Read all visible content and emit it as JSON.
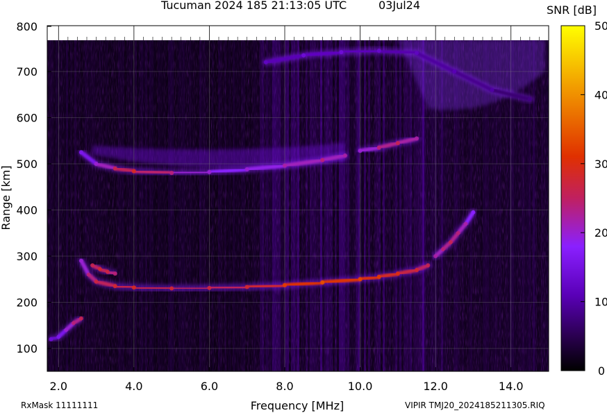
{
  "header": {
    "title": "Tucuman 2024 185 21:13:05 UTC",
    "date": "03Jul24"
  },
  "footer": {
    "rxmask": "RxMask 11111111",
    "file": "VIPIR  TMJ20_2024185211305.RIQ"
  },
  "chart_data": {
    "type": "heatmap",
    "title": "Tucuman 2024 185 21:13:05 UTC",
    "xlabel": "Frequency [MHz]",
    "ylabel": "Range [km]",
    "xlim": [
      1.7,
      15.0
    ],
    "ylim": [
      50,
      800
    ],
    "x_ticks": [
      "2.0",
      "4.0",
      "6.0",
      "8.0",
      "10.0",
      "12.0",
      "14.0"
    ],
    "x_tick_values": [
      2,
      4,
      6,
      8,
      10,
      12,
      14
    ],
    "y_ticks": [
      "100",
      "200",
      "300",
      "400",
      "500",
      "600",
      "700",
      "800"
    ],
    "y_tick_values": [
      100,
      200,
      300,
      400,
      500,
      600,
      700,
      800
    ],
    "colorbar": {
      "label": "SNR [dB]",
      "range": [
        0,
        50
      ],
      "ticks": [
        "0",
        "10",
        "20",
        "30",
        "40",
        "50"
      ],
      "tick_values": [
        0,
        10,
        20,
        30,
        40,
        50
      ],
      "colormap": [
        "#000000",
        "#2a0050",
        "#5a00b8",
        "#8a20ff",
        "#c02060",
        "#e03000",
        "#f09000",
        "#ffff00"
      ]
    },
    "grid": true,
    "traces": [
      {
        "kind": "F-layer virtual height (O)",
        "x": [
          2.6,
          2.8,
          3.0,
          3.5,
          4.0,
          5.0,
          6.0,
          7.0,
          8.0,
          9.0,
          10.0,
          10.5,
          11.0,
          11.5,
          11.8
        ],
        "y": [
          290,
          260,
          245,
          235,
          232,
          230,
          231,
          233,
          237,
          243,
          250,
          255,
          262,
          270,
          280
        ],
        "snr": [
          18,
          22,
          25,
          26,
          27,
          26,
          25,
          26,
          30,
          32,
          31,
          30,
          28,
          26,
          24
        ]
      },
      {
        "kind": "F-layer upper branch",
        "x": [
          2.9,
          3.1,
          3.3,
          3.5
        ],
        "y": [
          280,
          272,
          266,
          262
        ],
        "snr": [
          24,
          26,
          25,
          22
        ]
      },
      {
        "kind": "Multi-hop echo",
        "x": [
          2.6,
          3.0,
          3.5,
          4.0,
          5.0,
          6.0,
          7.0,
          8.0,
          9.0,
          9.6
        ],
        "y": [
          525,
          500,
          490,
          484,
          480,
          482,
          488,
          496,
          508,
          518
        ],
        "snr": [
          14,
          18,
          24,
          27,
          22,
          18,
          18,
          20,
          22,
          20
        ]
      },
      {
        "kind": "Multi-hop echo (high freq)",
        "x": [
          10.0,
          10.5,
          11.0,
          11.5
        ],
        "y": [
          528,
          535,
          545,
          555
        ],
        "snr": [
          18,
          22,
          24,
          20
        ]
      },
      {
        "kind": "E / Es echoes",
        "x": [
          1.8,
          2.0,
          2.2,
          2.4,
          2.6
        ],
        "y": [
          120,
          125,
          140,
          155,
          165
        ],
        "snr": [
          12,
          14,
          18,
          22,
          24
        ]
      },
      {
        "kind": "X-mode near cusp",
        "x": [
          12.0,
          12.2,
          12.4,
          12.6,
          12.8,
          13.0
        ],
        "y": [
          300,
          315,
          330,
          350,
          370,
          395
        ],
        "snr": [
          20,
          22,
          24,
          22,
          20,
          16
        ]
      },
      {
        "kind": "Diffuse upper echo",
        "x": [
          7.5,
          8.5,
          9.5,
          10.5,
          11.5,
          12.5,
          13.5,
          14.5
        ],
        "y": [
          720,
          735,
          742,
          745,
          740,
          700,
          660,
          640
        ],
        "snr": [
          10,
          12,
          12,
          11,
          10,
          9,
          8,
          6
        ]
      }
    ]
  }
}
